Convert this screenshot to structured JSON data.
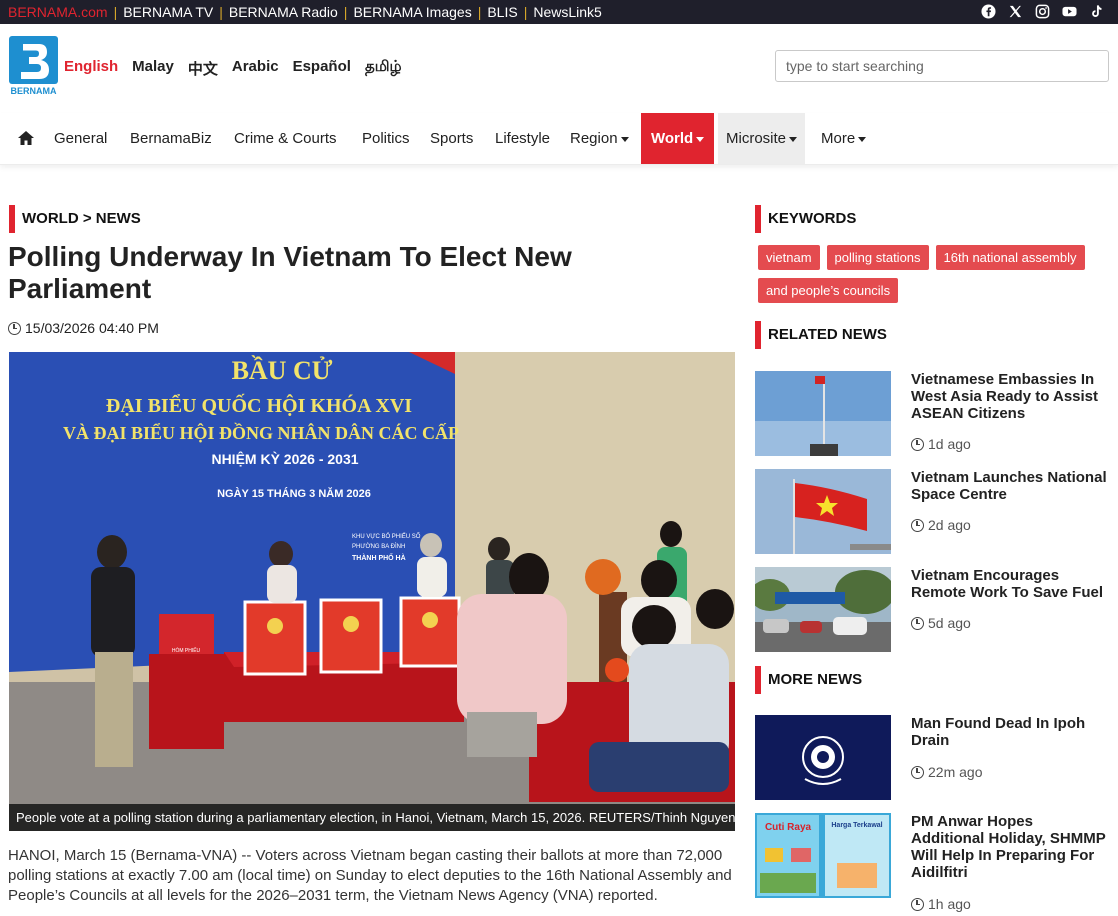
{
  "topbar": {
    "links": [
      "BERNAMA.com",
      "BERNAMA TV",
      "BERNAMA Radio",
      "BERNAMA Images",
      "BLIS",
      "NewsLink5"
    ],
    "social_icons": [
      "facebook-icon",
      "x-icon",
      "instagram-icon",
      "youtube-icon",
      "tiktok-icon"
    ]
  },
  "header": {
    "logo_text": "BERNAMA",
    "languages": [
      "English",
      "Malay",
      "中文",
      "Arabic",
      "Español",
      "தமிழ்"
    ],
    "active_language": "English",
    "search_placeholder": "type to start searching"
  },
  "nav": {
    "items": [
      "General",
      "BernamaBiz",
      "Crime & Courts",
      "Politics",
      "Sports",
      "Lifestyle",
      "Region",
      "World",
      "Microsite",
      "More"
    ],
    "active": "World"
  },
  "article": {
    "breadcrumb": "WORLD > NEWS",
    "title": "Polling Underway In Vietnam To Elect New Parliament",
    "datetime": "15/03/2026 04:40 PM",
    "photo": {
      "banner_lines": [
        "BẦU CỬ",
        "ĐẠI BIỂU QUỐC HỘI KHÓA XVI",
        "VÀ ĐẠI BIỂU HỘI ĐỒNG NHÂN DÂN CÁC CẤP",
        "NHIỆM KỲ 2026 - 2031",
        "NGÀY 15 THÁNG 3 NĂM 2026"
      ],
      "sign_lines": [
        "KHU VỰC BỎ PHIẾU SỐ",
        "PHƯỜNG BA ĐÌNH",
        "THÀNH PHỐ HÀ"
      ],
      "box_label": "HÒM PHIẾU",
      "caption": "People vote at a polling station during a parliamentary election, in Hanoi, Vietnam, March 15, 2026. REUTERS/Thinh Nguyen"
    },
    "body": "HANOI, March 15 (Bernama-VNA) -- Voters across Vietnam began casting their ballots at more than 72,000 polling stations at exactly 7.00 am (local time) on Sunday to elect deputies to the 16th National Assembly and People’s Councils at all levels for the 2026–2031 term, the Vietnam News Agency (VNA) reported."
  },
  "keywords": {
    "heading": "KEYWORDS",
    "tags": [
      "vietnam",
      "polling stations",
      "16th national assembly",
      "and people’s councils"
    ]
  },
  "related": {
    "heading": "RELATED NEWS",
    "items": [
      {
        "title": "Vietnamese Embassies In West Asia Ready to Assist ASEAN Citizens",
        "ago": "1d ago"
      },
      {
        "title": "Vietnam Launches National Space Centre",
        "ago": "2d ago"
      },
      {
        "title": "Vietnam Encourages Remote Work To Save Fuel",
        "ago": "5d ago"
      }
    ]
  },
  "more": {
    "heading": "MORE NEWS",
    "items": [
      {
        "title": "Man Found Dead In Ipoh Drain",
        "ago": "22m ago"
      },
      {
        "title": "PM Anwar Hopes Additional Holiday, SHMMP Will Help In Preparing For Aidilfitri",
        "ago": "1h ago",
        "thumb_texts": [
          "Cuti Raya",
          "Harga Terkawal"
        ]
      }
    ]
  },
  "colors": {
    "accent": "#e0242f",
    "topbar": "#1f1f2b",
    "tag": "#e44b4f"
  }
}
